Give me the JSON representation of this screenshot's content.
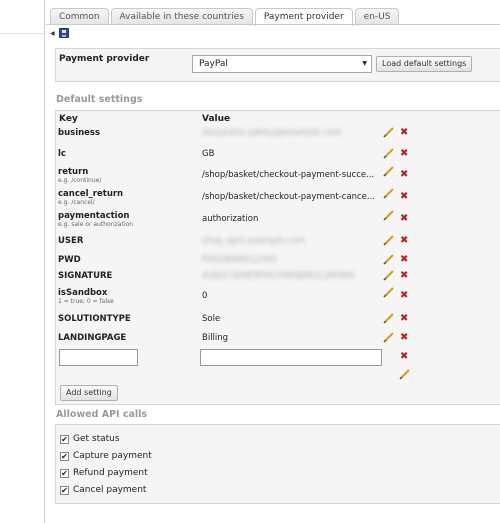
{
  "tabs": [
    "Common",
    "Available in these countries",
    "Payment provider",
    "en-US"
  ],
  "provider": {
    "label": "Payment provider",
    "selected": "PayPal",
    "load_button": "Load default settings"
  },
  "defaults": {
    "title": "Default settings",
    "col_key": "Key",
    "col_value": "Value",
    "rows": [
      {
        "key": "business",
        "hint": "",
        "value": "alexandra.oakley@example.com"
      },
      {
        "key": "lc",
        "hint": "",
        "value": "GB"
      },
      {
        "key": "return",
        "hint": "e.g. /continue/",
        "value": "/shop/basket/checkout-payment-succe..."
      },
      {
        "key": "cancel_return",
        "hint": "e.g. /cancel/",
        "value": "/shop/basket/checkout-payment-cance..."
      },
      {
        "key": "paymentaction",
        "hint": "e.g. sale or authorization",
        "value": "authorization"
      },
      {
        "key": "USER",
        "hint": "",
        "value": "shop_api1.example.com"
      },
      {
        "key": "PWD",
        "hint": "",
        "value": "P4SSW0RD12345"
      },
      {
        "key": "SIGNATURE",
        "hint": "",
        "value": "A1B2C3D4E5F6G7H8I9J0K1L2M3N4"
      },
      {
        "key": "isSandbox",
        "hint": "1 = true; 0 = false",
        "value": "0"
      },
      {
        "key": "SOLUTIONTYPE",
        "hint": "",
        "value": "Sole"
      },
      {
        "key": "LANDINGPAGE",
        "hint": "",
        "value": "Billing"
      }
    ],
    "new_key": "",
    "new_value": "",
    "add_button": "Add setting"
  },
  "api": {
    "title": "Allowed API calls",
    "calls": [
      {
        "label": "Get status",
        "checked": true
      },
      {
        "label": "Capture payment",
        "checked": true
      },
      {
        "label": "Refund payment",
        "checked": true
      },
      {
        "label": "Cancel payment",
        "checked": true
      }
    ]
  },
  "colors": {
    "delete": "#c01e1e",
    "pencil": "#d4a017",
    "section_title": "#999999"
  }
}
